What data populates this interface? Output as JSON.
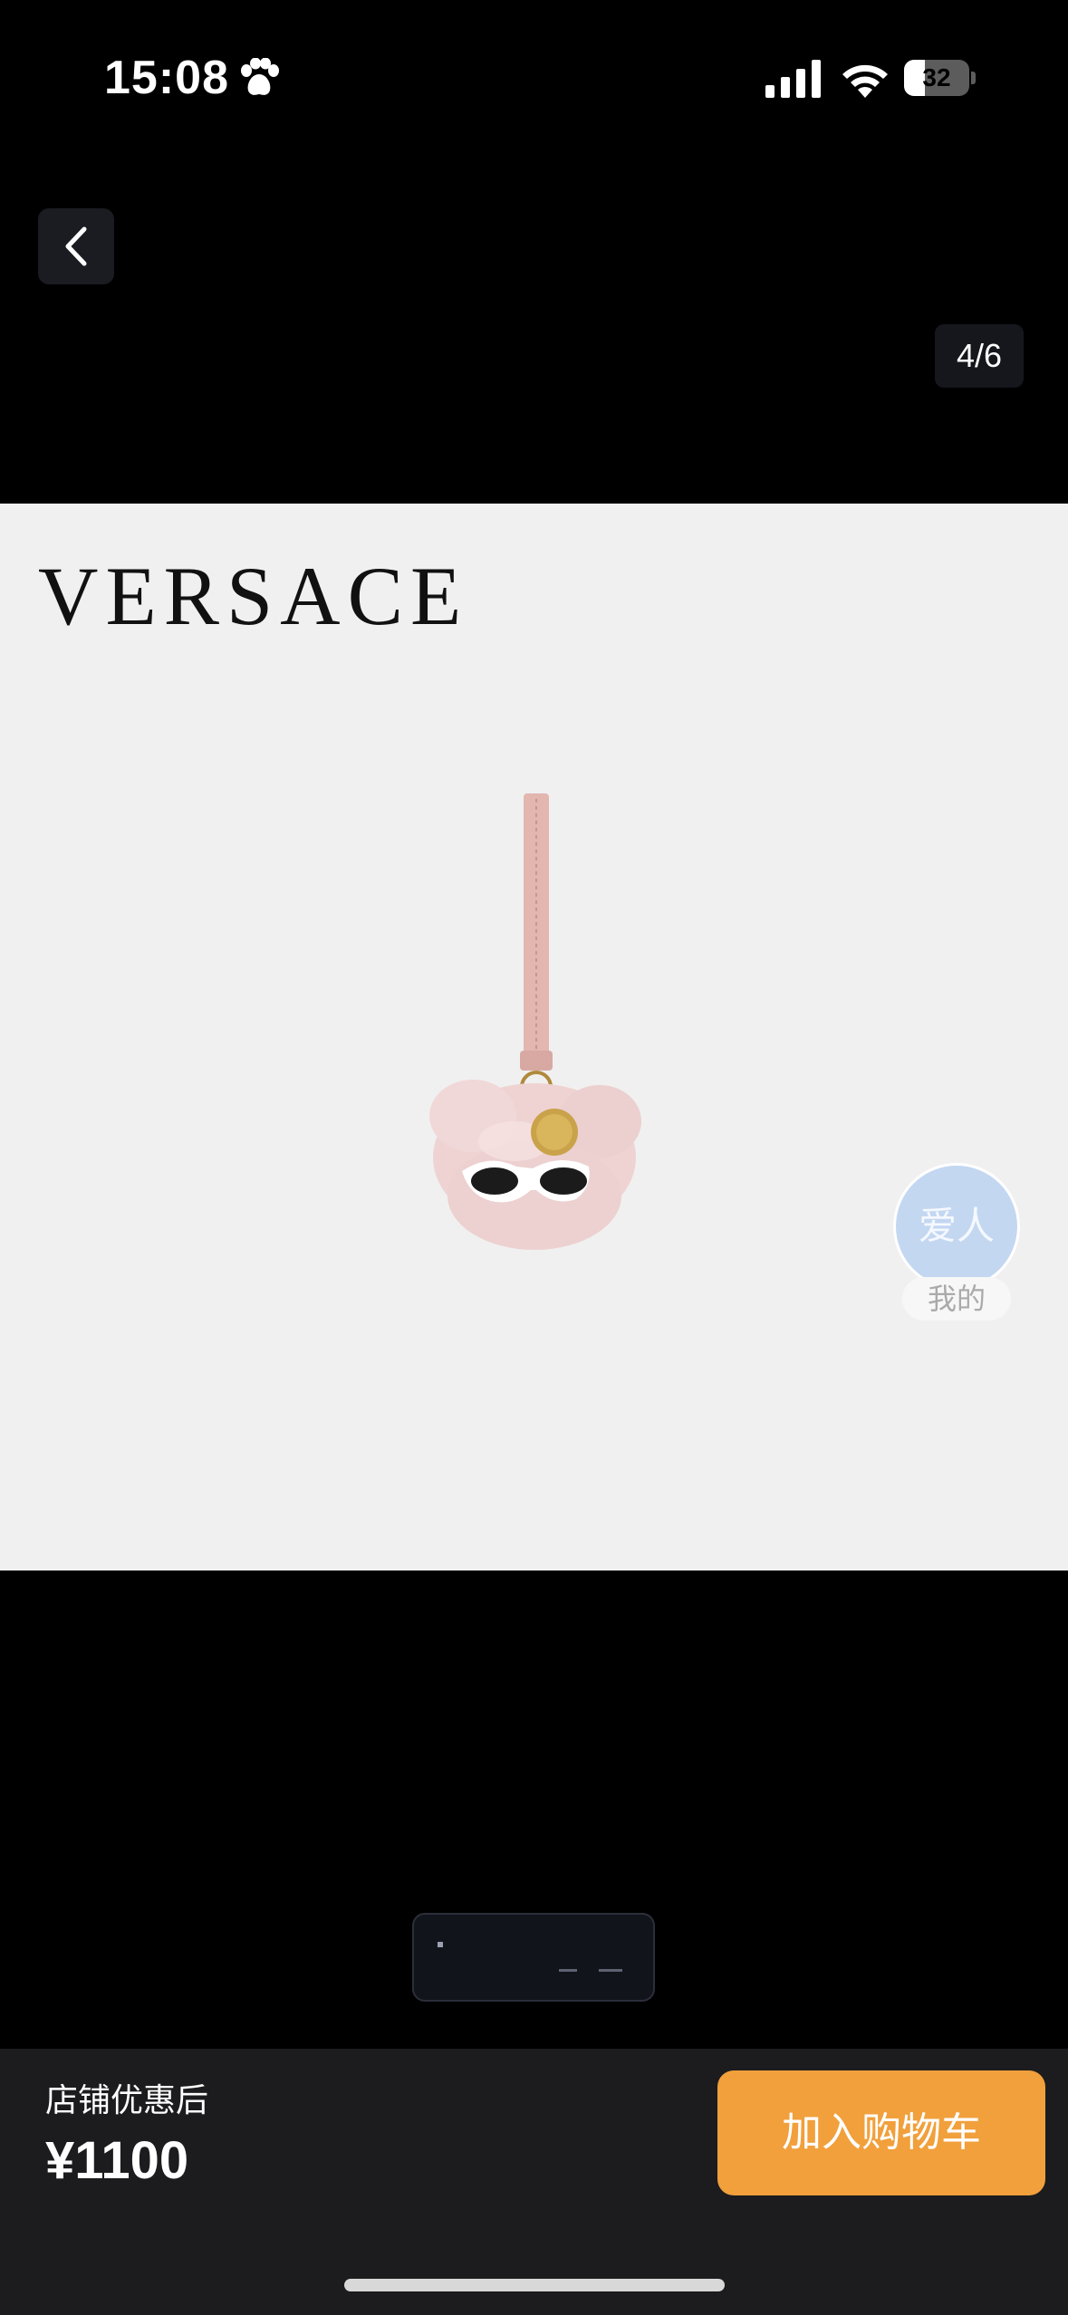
{
  "status_bar": {
    "time": "15:08",
    "battery_level": "32",
    "icons": [
      "paw-icon",
      "cellular-signal-icon",
      "wifi-icon",
      "battery-icon"
    ]
  },
  "gallery": {
    "counter": "4/6",
    "back_icon": "chevron-left-icon"
  },
  "product_image": {
    "brand_text": "VERSACE",
    "background_color": "#f0f0f0"
  },
  "floating_widget": {
    "circle_text": "爱人",
    "tag_text": "我的",
    "circle_color": "#c3d7f1"
  },
  "bottom_bar": {
    "price_label": "店铺优惠后",
    "price": "¥1100",
    "add_to_cart_label": "加入购物车",
    "button_color": "#f1a03c"
  }
}
